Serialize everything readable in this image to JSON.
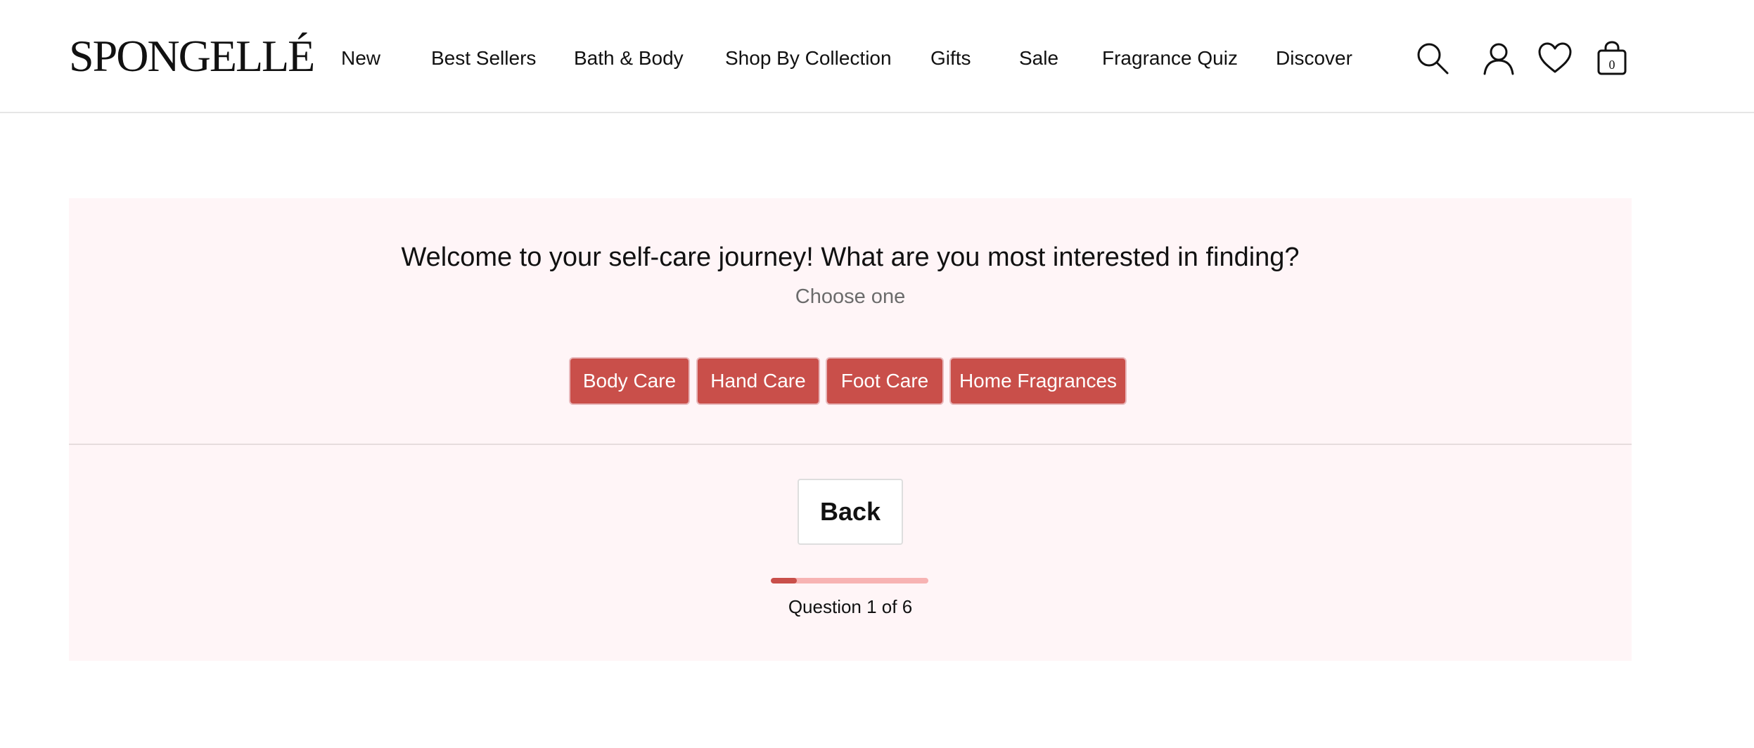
{
  "header": {
    "logo_text": "SPONGELLÉ",
    "nav": [
      {
        "label": "New"
      },
      {
        "label": "Best Sellers"
      },
      {
        "label": "Bath & Body"
      },
      {
        "label": "Shop By Collection"
      },
      {
        "label": "Gifts"
      },
      {
        "label": "Sale"
      },
      {
        "label": "Fragrance Quiz"
      },
      {
        "label": "Discover"
      }
    ],
    "icons": {
      "search": "search-icon",
      "account": "user-icon",
      "wishlist": "heart-icon",
      "cart": "shopping-bag-icon"
    },
    "cart_count": "0"
  },
  "quiz": {
    "question": "Welcome to your self-care journey! What are you most interested in finding?",
    "instruction": "Choose one",
    "options": [
      {
        "label": "Body Care"
      },
      {
        "label": "Hand Care"
      },
      {
        "label": "Foot Care"
      },
      {
        "label": "Home Fragrances"
      }
    ],
    "back_label": "Back",
    "progress": {
      "current": 1,
      "total": 6,
      "label": "Question 1 of 6",
      "fraction": 0.167
    }
  },
  "colors": {
    "accent": "#c94f4a",
    "panel_bg": "#fff5f7",
    "progress_track": "#f7b3b3"
  }
}
